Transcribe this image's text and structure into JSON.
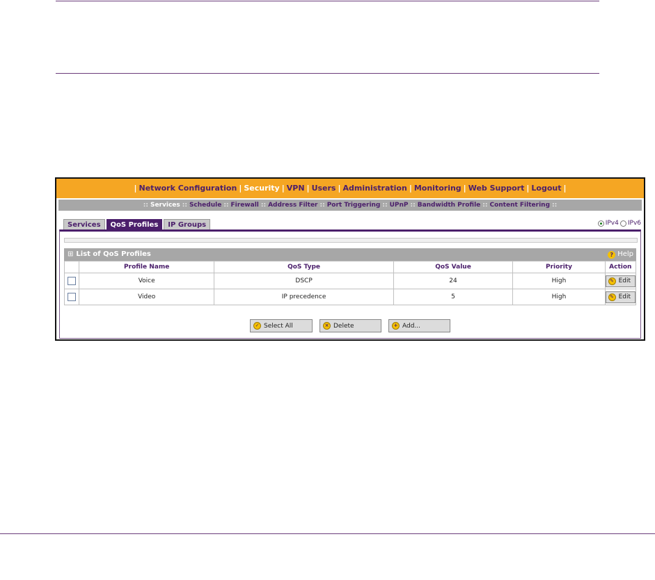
{
  "menu": {
    "separator": "|",
    "items": [
      {
        "label": "Network Configuration",
        "active": false
      },
      {
        "label": "Security",
        "active": true
      },
      {
        "label": "VPN",
        "active": false
      },
      {
        "label": "Users",
        "active": false
      },
      {
        "label": "Administration",
        "active": false
      },
      {
        "label": "Monitoring",
        "active": false
      },
      {
        "label": "Web Support",
        "active": false
      },
      {
        "label": "Logout",
        "active": false
      }
    ]
  },
  "submenu": {
    "separator": "::",
    "items": [
      {
        "label": "Services",
        "active": true
      },
      {
        "label": "Schedule",
        "active": false
      },
      {
        "label": "Firewall",
        "active": false
      },
      {
        "label": "Address Filter",
        "active": false
      },
      {
        "label": "Port Triggering",
        "active": false
      },
      {
        "label": "UPnP",
        "active": false
      },
      {
        "label": "Bandwidth Profile",
        "active": false
      },
      {
        "label": "Content Filtering",
        "active": false
      }
    ]
  },
  "tabs": [
    {
      "label": "Services",
      "active": false
    },
    {
      "label": "QoS Profiles",
      "active": true
    },
    {
      "label": "IP Groups",
      "active": false
    }
  ],
  "ip_version": {
    "ipv4": "IPv4",
    "ipv6": "IPv6",
    "selected": "IPv4"
  },
  "list": {
    "title": "List of QoS Profiles",
    "help_label": "Help",
    "columns": [
      "Profile Name",
      "QoS Type",
      "QoS Value",
      "Priority",
      "Action"
    ],
    "rows": [
      {
        "name": "Voice",
        "type": "DSCP",
        "value": "24",
        "priority": "High",
        "action": "Edit"
      },
      {
        "name": "Video",
        "type": "IP precedence",
        "value": "5",
        "priority": "High",
        "action": "Edit"
      }
    ]
  },
  "buttons": {
    "select_all": "Select All",
    "delete": "Delete",
    "add": "Add..."
  },
  "colors": {
    "menu_bg": "#f5a623",
    "accent_purple": "#4b1f6b",
    "submenu_bg": "#a7a7a7"
  }
}
